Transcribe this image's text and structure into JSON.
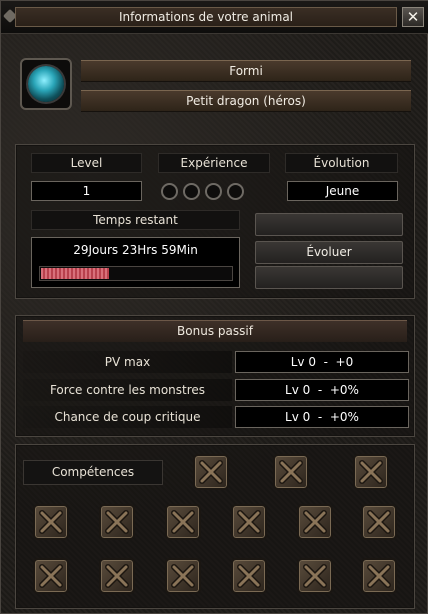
{
  "window": {
    "title": "Informations de votre animal",
    "close_icon": "close-icon"
  },
  "pet": {
    "icon": "pet-egg-icon",
    "name": "Formi",
    "type": "Petit dragon (héros)"
  },
  "stats": {
    "level_label": "Level",
    "experience_label": "Expérience",
    "evolution_label": "Évolution",
    "level_value": "1",
    "experience_orbs_filled": 0,
    "experience_orbs_total": 4,
    "evolution_value": "Jeune",
    "time_label": "Temps restant",
    "time_value": "29Jours 23Hrs 59Min",
    "time_progress": 0.36,
    "evolve_button": "Évoluer",
    "bar_color": "#d8707a"
  },
  "bonus": {
    "title": "Bonus passif",
    "rows": [
      {
        "label": "PV max",
        "value": "Lv 0  -  +0"
      },
      {
        "label": "Force contre les monstres",
        "value": "Lv 0  -  +0%"
      },
      {
        "label": "Chance de coup critique",
        "value": "Lv 0  -  +0%"
      }
    ]
  },
  "skills": {
    "label": "Compétences",
    "slot_icon": "locked-slot-icon"
  }
}
